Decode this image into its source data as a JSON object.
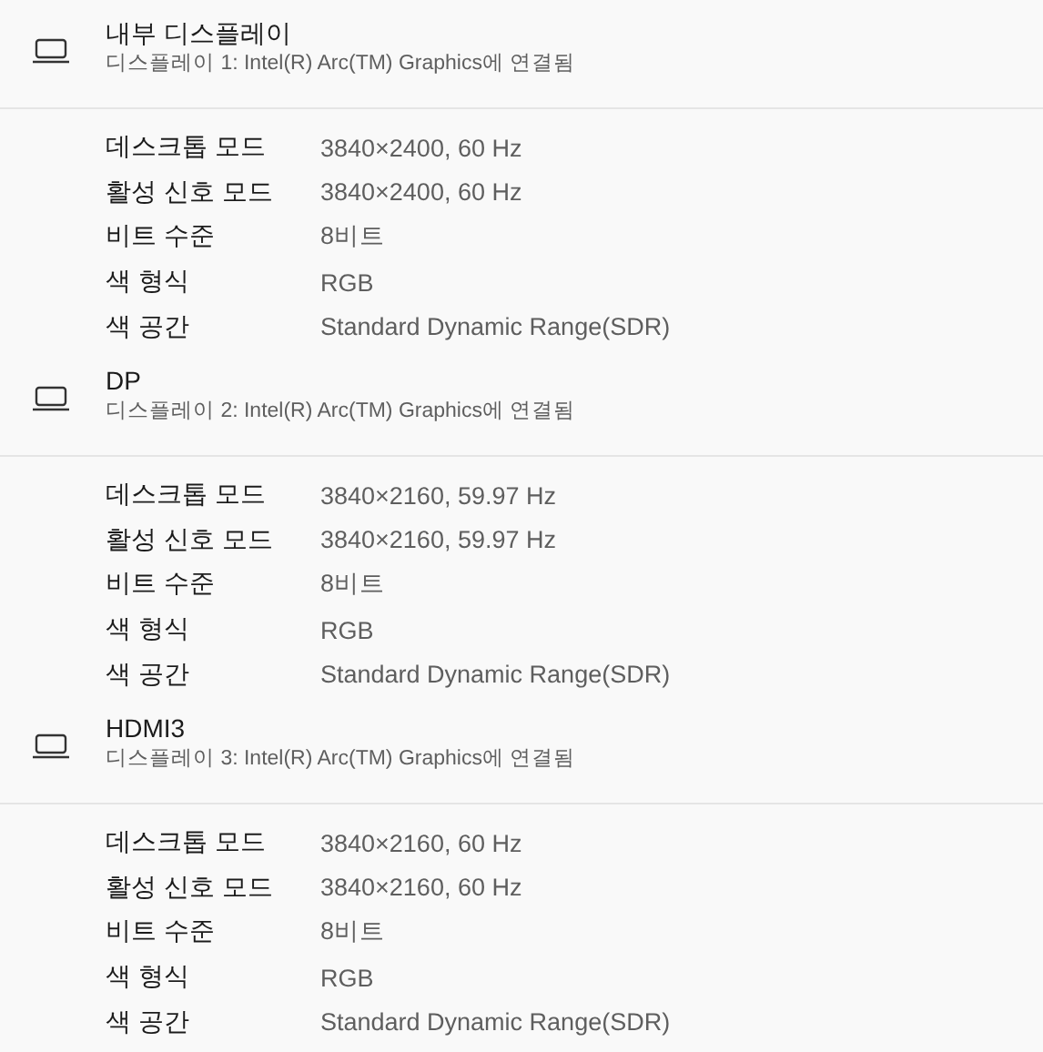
{
  "displays": [
    {
      "name": "내부 디스플레이",
      "subtitle": "디스플레이 1: Intel(R) Arc(TM) Graphics에 연결됨",
      "properties": [
        {
          "label": "데스크톱 모드",
          "value": "3840×2400, 60 Hz"
        },
        {
          "label": "활성 신호 모드",
          "value": "3840×2400, 60 Hz"
        },
        {
          "label": "비트 수준",
          "value": "8비트"
        },
        {
          "label": "색 형식",
          "value": "RGB"
        },
        {
          "label": "색 공간",
          "value": "Standard Dynamic Range(SDR)"
        }
      ]
    },
    {
      "name": "DP",
      "subtitle": "디스플레이 2: Intel(R) Arc(TM) Graphics에 연결됨",
      "properties": [
        {
          "label": "데스크톱 모드",
          "value": "3840×2160, 59.97 Hz"
        },
        {
          "label": "활성 신호 모드",
          "value": "3840×2160, 59.97 Hz"
        },
        {
          "label": "비트 수준",
          "value": "8비트"
        },
        {
          "label": "색 형식",
          "value": "RGB"
        },
        {
          "label": "색 공간",
          "value": "Standard Dynamic Range(SDR)"
        }
      ]
    },
    {
      "name": "HDMI3",
      "subtitle": "디스플레이 3: Intel(R) Arc(TM) Graphics에 연결됨",
      "properties": [
        {
          "label": "데스크톱 모드",
          "value": "3840×2160, 60 Hz"
        },
        {
          "label": "활성 신호 모드",
          "value": "3840×2160, 60 Hz"
        },
        {
          "label": "비트 수준",
          "value": "8비트"
        },
        {
          "label": "색 형식",
          "value": "RGB"
        },
        {
          "label": "색 공간",
          "value": "Standard Dynamic Range(SDR)"
        }
      ]
    }
  ]
}
